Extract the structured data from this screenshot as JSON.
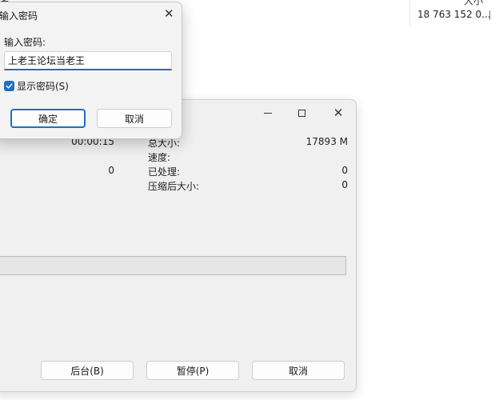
{
  "background": {
    "list_header_fragment": "名",
    "size_column_header": "大小",
    "file_size": "18 763 152 0..."
  },
  "progress_window": {
    "elapsed_time": "00:00:15",
    "left_value_2": "0",
    "labels": {
      "total_size": "总大小:",
      "speed": "速度:",
      "processed": "已处理:",
      "compressed_size": "压缩后大小:"
    },
    "values": {
      "total_size": "17893 M",
      "processed": "0",
      "compressed_size": "0"
    },
    "progress_percent": 0,
    "buttons": {
      "background": "后台(B)",
      "pause": "暂停(P)",
      "cancel": "取消"
    },
    "close_glyph": "✕"
  },
  "password_dialog": {
    "title": "输入密码",
    "prompt_label": "输入密码:",
    "password_value": "上老王论坛当老王",
    "show_password_label": "显示密码(S)",
    "show_password_checked": true,
    "ok_label": "确定",
    "cancel_label": "取消",
    "close_glyph": "✕"
  },
  "colors": {
    "accent": "#1f6fc0",
    "window_bg": "#f0f0f0"
  }
}
